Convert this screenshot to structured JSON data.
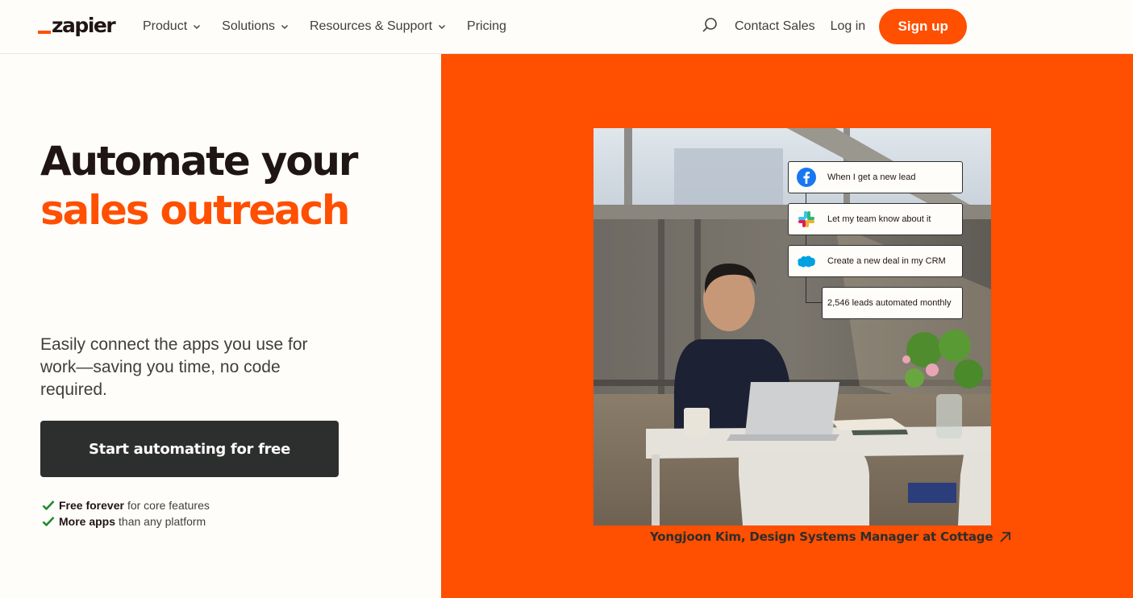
{
  "header": {
    "logo_text": "zapier",
    "nav": [
      {
        "label": "Product",
        "has_dropdown": true
      },
      {
        "label": "Solutions",
        "has_dropdown": true
      },
      {
        "label": "Resources & Support",
        "has_dropdown": true
      },
      {
        "label": "Pricing",
        "has_dropdown": false
      }
    ],
    "search_icon": "search-icon",
    "contact_sales": "Contact Sales",
    "log_in": "Log in",
    "sign_up": "Sign up"
  },
  "hero": {
    "title_line1": "Automate your",
    "title_line2": "sales outreach",
    "subtitle": "Easily connect the apps you use for work—saving you time, no code required.",
    "cta_label": "Start automating for free",
    "checks": [
      {
        "bold": "Free forever",
        "rest": "for core features"
      },
      {
        "bold": "More apps",
        "rest": "than any platform"
      }
    ]
  },
  "showcase": {
    "workflow": [
      {
        "app": "facebook",
        "text": "When I get a new lead"
      },
      {
        "app": "slack",
        "text": "Let my team know about it"
      },
      {
        "app": "salesforce",
        "text": "Create a new deal in my CRM"
      },
      {
        "app": "",
        "text": "2,546 leads automated monthly"
      }
    ],
    "caption": "Yongjoon Kim, Design Systems Manager at Cottage"
  },
  "colors": {
    "brand_orange": "#ff4f00",
    "dark": "#2d2e2e",
    "background": "#fffdf9",
    "check_green": "#1f8a2f"
  }
}
